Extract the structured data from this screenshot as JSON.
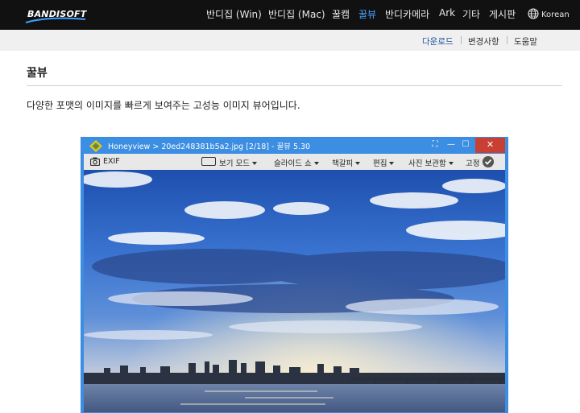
{
  "brand": {
    "logo_text": "BANDISOFT"
  },
  "nav": {
    "items": [
      {
        "label": "반디집 (Win)",
        "active": false
      },
      {
        "label": "반디집 (Mac)",
        "active": false
      },
      {
        "label": "꿀캠",
        "active": false
      },
      {
        "label": "꿀뷰",
        "active": true
      },
      {
        "label": "반디카메라",
        "active": false
      },
      {
        "label": "Ark",
        "active": false
      },
      {
        "label": "기타",
        "active": false
      },
      {
        "label": "게시판",
        "active": false
      }
    ],
    "language": "Korean"
  },
  "subnav": {
    "items": [
      {
        "label": "다운로드",
        "active": true
      },
      {
        "label": "변경사항",
        "active": false
      },
      {
        "label": "도움말",
        "active": false
      }
    ]
  },
  "content": {
    "title": "꿀뷰",
    "description": "다양한 포맷의 이미지를 빠르게 보여주는 고성능 이미지 뷰어입니다."
  },
  "app_window": {
    "title": "Honeyview  >  20ed248381b5a2.jpg  [2/18]  -  꿀뷰  5.30",
    "buttons": {
      "fullscreen": "⛶",
      "minimize": "—",
      "maximize": "☐",
      "close": "✕"
    },
    "toolbar": {
      "exif": "EXIF",
      "view_mode": "보기 모드",
      "slideshow": "슬라이드 쇼",
      "bookmark": "책갈피",
      "edit": "편집",
      "photo_archive": "사진 보관함",
      "pin": "고정"
    }
  },
  "colors": {
    "nav_bg": "#111111",
    "nav_active": "#4aa3ff",
    "subnav_bg": "#f0f0f0",
    "subnav_active": "#1a4f9c",
    "window_frame": "#3b8ee2",
    "close_red": "#c83f33"
  }
}
